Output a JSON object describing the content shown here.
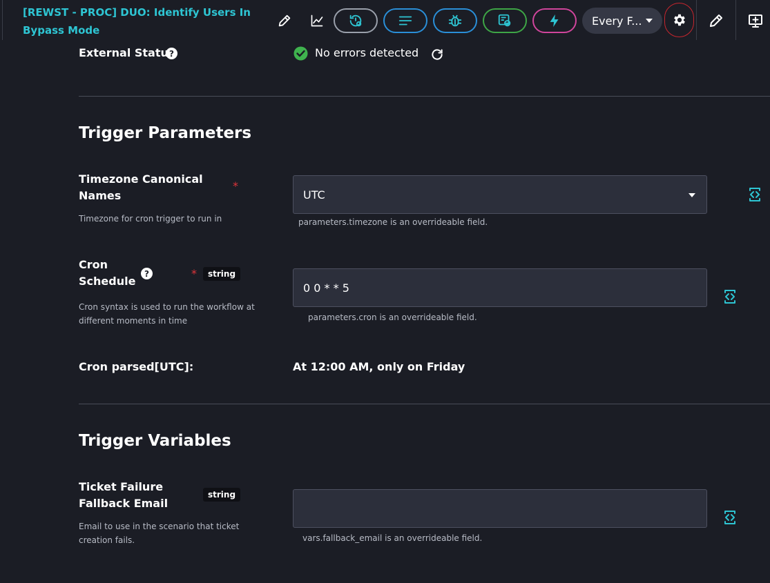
{
  "header": {
    "title": "[REWST - PROC] DUO: Identify Users In Bypass Mode",
    "schedule_label": "Every F...",
    "icons": [
      "pencil-icon",
      "chart-icon",
      "history-settings-icon",
      "lines-icon",
      "bug-icon",
      "calendar-link-icon",
      "lightning-icon",
      "gear-icon",
      "edit-icon",
      "add-screen-icon"
    ],
    "pill_colors": {
      "history": "#9aa0ab",
      "logs": "#2a8fd8",
      "debug": "#2a8fd8",
      "links": "#3ea646",
      "trigger": "#d0459c"
    }
  },
  "external_status": {
    "label": "External Status",
    "value": "No errors detected"
  },
  "trigger_parameters": {
    "title": "Trigger Parameters",
    "timezone": {
      "label": "Timezone Canonical Names",
      "help": "Timezone for cron trigger to run in",
      "value": "UTC",
      "hint": "parameters.timezone is an overrideable field.",
      "required": "*"
    },
    "cron": {
      "label": "Cron Schedule",
      "help": "Cron syntax is used to run the workflow at different moments in time",
      "type_tag": "string",
      "value": "0 0 * * 5",
      "hint": "parameters.cron is an overrideable field.",
      "required": "*"
    },
    "cron_parsed": {
      "label": "Cron parsed[UTC]:",
      "value": "At 12:00 AM, only on Friday"
    }
  },
  "trigger_variables": {
    "title": "Trigger Variables",
    "fallback_email": {
      "label": "Ticket Failure Fallback Email",
      "help": "Email to use in the scenario that ticket creation fails.",
      "type_tag": "string",
      "value": "",
      "hint": "vars.fallback_email is an overrideable field."
    }
  },
  "colors": {
    "accent": "#2ec5d3",
    "success": "#3fb24e",
    "required": "#e0343a",
    "background": "#1b1d25"
  }
}
